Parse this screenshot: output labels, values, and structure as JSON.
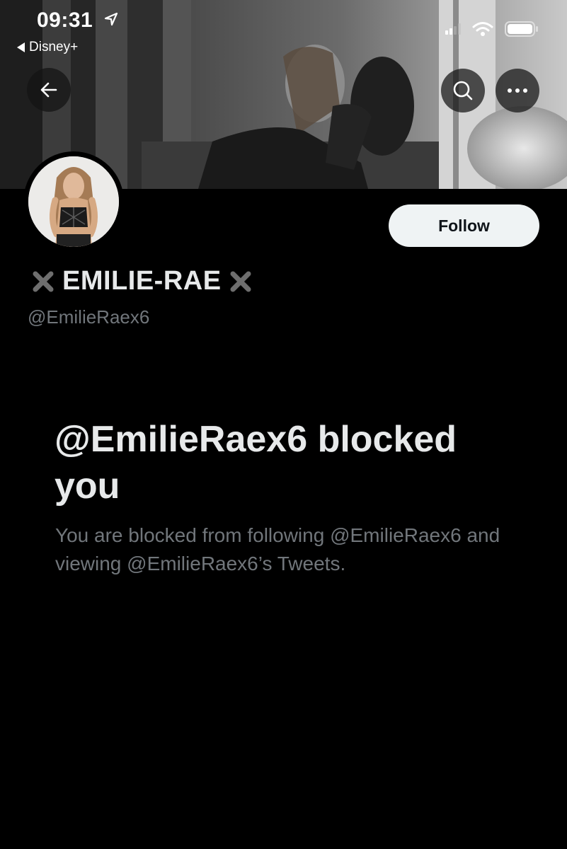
{
  "status_bar": {
    "time": "09:31",
    "back_app": "Disney+"
  },
  "header": {
    "back_icon": "arrow-left-icon",
    "search_icon": "search-icon",
    "more_icon": "more-horizontal-icon"
  },
  "profile": {
    "display_name": "EMILIE-RAE",
    "name_decoration_icon": "heavy-x-mark-icon",
    "handle": "@EmilieRaex6",
    "follow_label": "Follow"
  },
  "blocked_notice": {
    "title": "@EmilieRaex6 blocked you",
    "description": "You are blocked from following @EmilieRaex6 and viewing @EmilieRaex6’s Tweets."
  },
  "colors": {
    "background": "#000000",
    "primary_text": "#e7e9ea",
    "secondary_text": "#71767b",
    "follow_button_bg": "#eff3f4",
    "follow_button_text": "#0f1419"
  }
}
